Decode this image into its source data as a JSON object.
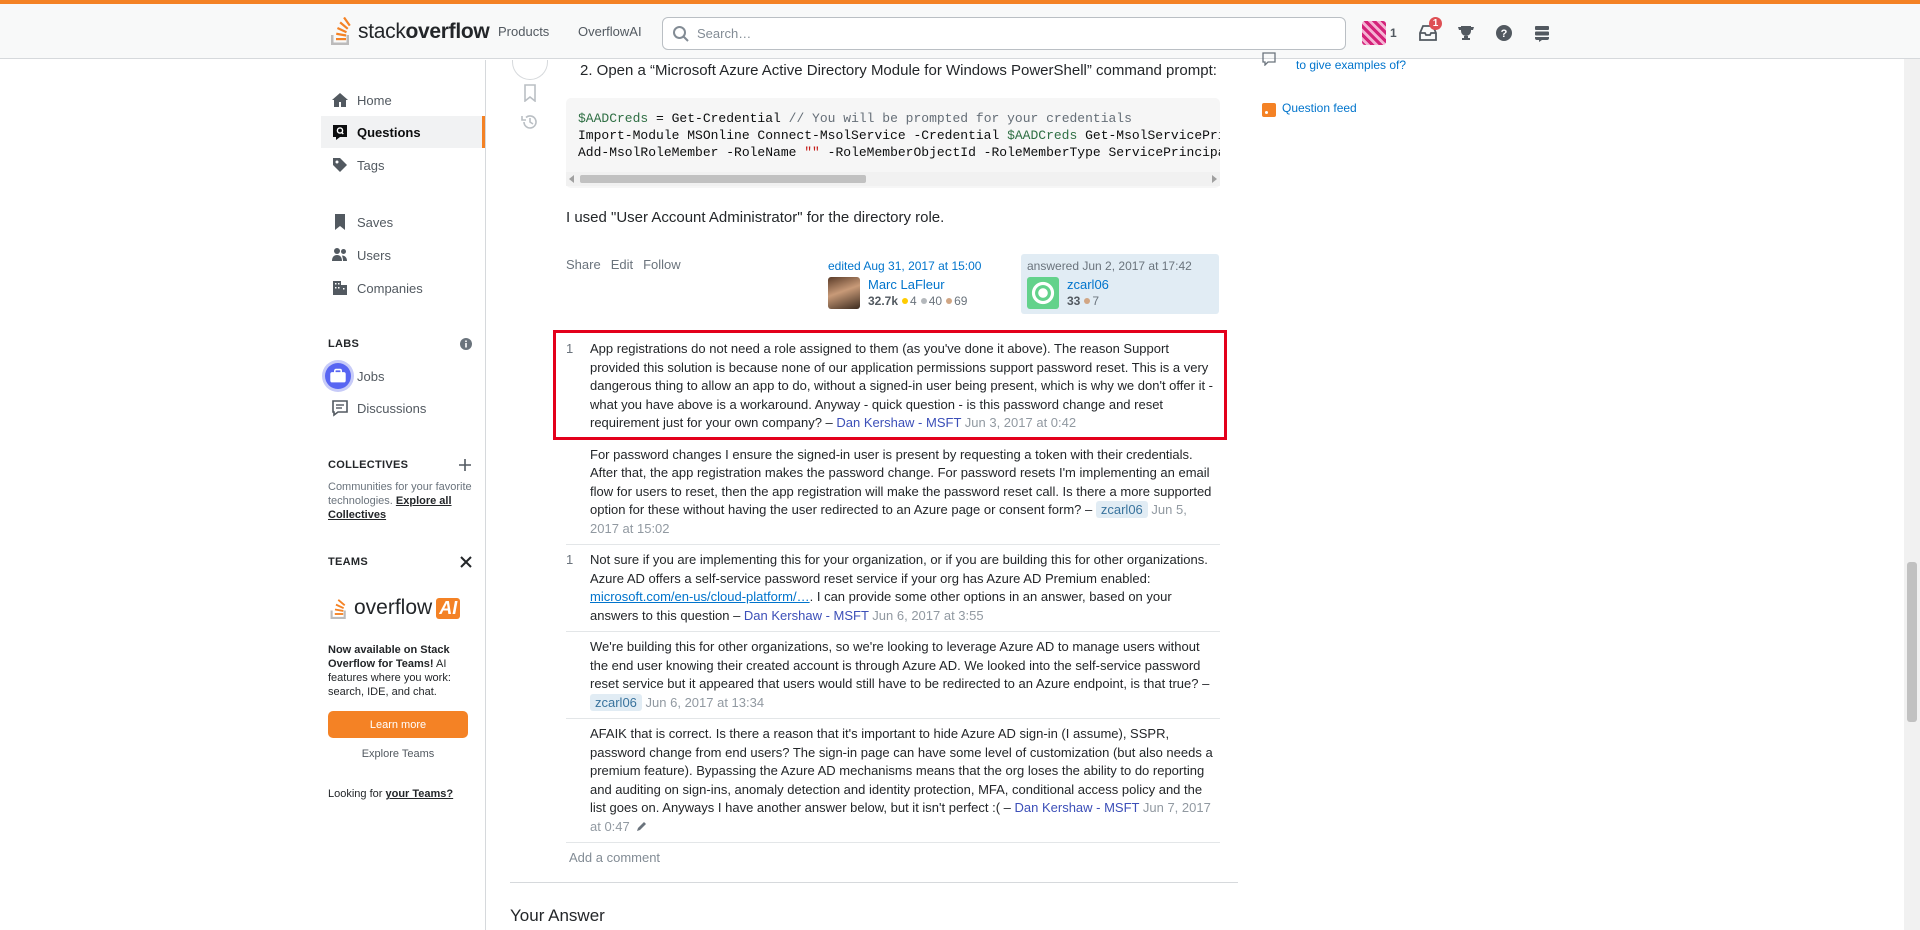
{
  "header": {
    "logo_word": "stack",
    "logo_bold": "overflow",
    "nav": [
      "Products",
      "OverflowAI"
    ],
    "search_placeholder": "Search…",
    "rep": "1",
    "inbox_count": "1"
  },
  "sidebar": {
    "items": [
      {
        "label": "Home",
        "icon": "home-icon"
      },
      {
        "label": "Questions",
        "icon": "questions-icon"
      },
      {
        "label": "Tags",
        "icon": "tag-icon"
      },
      {
        "label": "Saves",
        "icon": "bookmark-icon"
      },
      {
        "label": "Users",
        "icon": "users-icon"
      },
      {
        "label": "Companies",
        "icon": "building-icon"
      }
    ],
    "labs_heading": "LABS",
    "labs_items": [
      "Jobs",
      "Discussions"
    ],
    "collectives_heading": "COLLECTIVES",
    "collectives_text": "Communities for your favorite technologies.",
    "collectives_link": "Explore all Collectives",
    "teams_heading": "TEAMS",
    "ai_logo_word": "overflow",
    "ai_logo_badge": "AI",
    "ai_bold": "Now available on Stack Overflow for Teams!",
    "ai_rest": "AI features where you work: search, IDE, and chat.",
    "learn_more": "Learn more",
    "explore_teams": "Explore Teams",
    "looking_prefix": "Looking for",
    "looking_link": "your Teams?"
  },
  "answer": {
    "step_text": "2. Open a “Microsoft Azure Active Directory Module for Windows PowerShell” command prompt:",
    "code_line1_var": "$AADCreds",
    "code_line1_mid": " = Get-Credential ",
    "code_line1_comment": "// You will be prompted for your credentials",
    "code_line2_a": "Import-Module MSOnline Connect-MsolService -Credential ",
    "code_line2_var": "$AADCreds",
    "code_line2_b": " Get-MsolServicePri",
    "code_line3_a": "Add-MsolRoleMember -RoleName ",
    "code_line3_str": "\"\"",
    "code_line3_b": " -RoleMemberObjectId -RoleMemberType ServicePrincipa",
    "role_text": "I used \"User Account Administrator\" for the directory role.",
    "menu": [
      "Share",
      "Edit",
      "Follow"
    ],
    "edited": {
      "when": "edited Aug 31, 2017 at 15:00",
      "name": "Marc LaFleur",
      "rep": "32.7k",
      "gold": "4",
      "silver": "40",
      "bronze": "69"
    },
    "answered": {
      "when": "answered Jun 2, 2017 at 17:42",
      "name": "zcarl06",
      "rep": "33",
      "bronze": "7"
    }
  },
  "comments": [
    {
      "score": "1",
      "text": "App registrations do not need a role assigned to them (as you've done it above). The reason Support provided this solution is because none of our application permissions support password reset. This is a very dangerous thing to allow an app to do, without a signed-in user being present, which is why we don't offer it - what you have above is a workaround. Anyway - quick question - is this password change and reset requirement just for your own company? – ",
      "author": "Dan Kershaw - MSFT",
      "date": "Jun 3, 2017 at 0:42"
    },
    {
      "score": "",
      "text": "For password changes I ensure the signed-in user is present by requesting a token with their credentials. After that, the app registration makes the password change. For password resets I'm implementing an email flow for users to reset, then the app registration will make the password reset call. Is there a more supported option for these without having the user redirected to an Azure page or consent form? – ",
      "author": "zcarl06",
      "date": "Jun 5, 2017 at 15:02"
    },
    {
      "score": "1",
      "text_a": "Not sure if you are implementing this for your organization, or if you are building this for other organizations. Azure AD offers a self-service password reset service if your org has Azure AD Premium enabled: ",
      "link": "microsoft.com/en-us/cloud-platform/…",
      "text_b": ". I can provide some other options in an answer, based on your answers to this question – ",
      "author": "Dan Kershaw - MSFT",
      "date": "Jun 6, 2017 at 3:55"
    },
    {
      "score": "",
      "text": "We're building this for other organizations, so we're looking to leverage Azure AD to manage users without the end user knowing their created account is through Azure AD. We looked into the self-service password reset service but it appeared that users would still have to be redirected to an Azure endpoint, is that true? – ",
      "author": "zcarl06",
      "date": "Jun 6, 2017 at 13:34"
    },
    {
      "score": "",
      "text": "AFAIK that is correct. Is there a reason that it's important to hide Azure AD sign-in (I assume), SSPR, password change from end users? The sign-in page can have some level of customization (but also needs a premium feature). Bypassing the Azure AD mechanisms means that the org loses the ability to do reporting and auditing on sign-ins, anomaly detection and identity protection, MFA, conditional access policy and the list goes on. Anyways I have another answer below, but it isn't perfect :( – ",
      "author": "Dan Kershaw - MSFT",
      "date": "Jun 7, 2017 at 0:47"
    }
  ],
  "add_comment": "Add a comment",
  "your_answer": "Your Answer",
  "right": {
    "partial_link": "to give examples of?",
    "question_feed": "Question feed"
  },
  "colors": {
    "accent": "#f48225",
    "link": "#0074cc",
    "highlight": "#e3001b"
  }
}
